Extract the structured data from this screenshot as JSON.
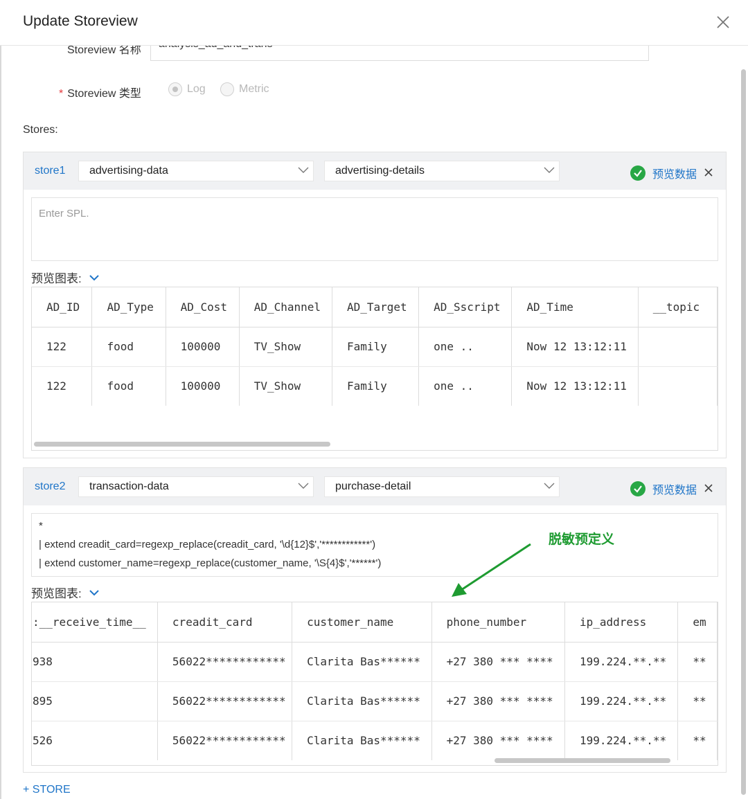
{
  "dialog": {
    "title": "Update Storeview"
  },
  "form": {
    "name_label": "Storeview 名称",
    "name_value": "analysis_ad_and_trans",
    "type_label": "Storeview 类型",
    "type_options": [
      "Log",
      "Metric"
    ],
    "type_selected": "Log",
    "stores_label": "Stores:"
  },
  "stores": [
    {
      "label": "store1",
      "project": "advertising-data",
      "logstore": "advertising-details",
      "preview_link": "预览数据",
      "spl_placeholder": "Enter SPL.",
      "spl_lines": [],
      "chart_label": "预览图表:",
      "columns": [
        "AD_ID",
        "AD_Type",
        "AD_Cost",
        "AD_Channel",
        "AD_Target",
        "AD_Sscript",
        "AD_Time",
        "__topic"
      ],
      "rows": [
        [
          "122",
          "food",
          "100000",
          "TV_Show",
          "Family",
          "one ..",
          "Now 12 13:12:11",
          ""
        ],
        [
          "122",
          "food",
          "100000",
          "TV_Show",
          "Family",
          "one ..",
          "Now 12 13:12:11",
          ""
        ]
      ]
    },
    {
      "label": "store2",
      "project": "transaction-data",
      "logstore": "purchase-detail",
      "preview_link": "预览数据",
      "spl_placeholder": "",
      "spl_lines": [
        "*",
        "| extend creadit_card=regexp_replace(creadit_card, '\\d{12}$','************')",
        "| extend customer_name=regexp_replace(customer_name, '\\S{4}$','******')"
      ],
      "chart_label": "预览图表:",
      "columns": [
        ":__receive_time__",
        "creadit_card",
        "customer_name",
        "phone_number",
        "ip_address",
        "em"
      ],
      "rows": [
        [
          "938",
          "56022************",
          "Clarita Bas******",
          "+27 380 *** ****",
          "199.224.**.**",
          "**"
        ],
        [
          "895",
          "56022************",
          "Clarita Bas******",
          "+27 380 *** ****",
          "199.224.**.**",
          "**"
        ],
        [
          "526",
          "56022************",
          "Clarita Bas******",
          "+27 380 *** ****",
          "199.224.**.**",
          "**"
        ]
      ]
    }
  ],
  "annotation": {
    "text": "脱敏预定义",
    "color": "#1e9b31"
  },
  "add_store_label": "+ STORE",
  "colors": {
    "accent": "#1f75c8",
    "success": "#28a745",
    "required": "#e4393c"
  },
  "icons": [
    "close-icon",
    "chevron-down-icon",
    "check-circle-icon",
    "remove-icon",
    "arrow-icon"
  ]
}
